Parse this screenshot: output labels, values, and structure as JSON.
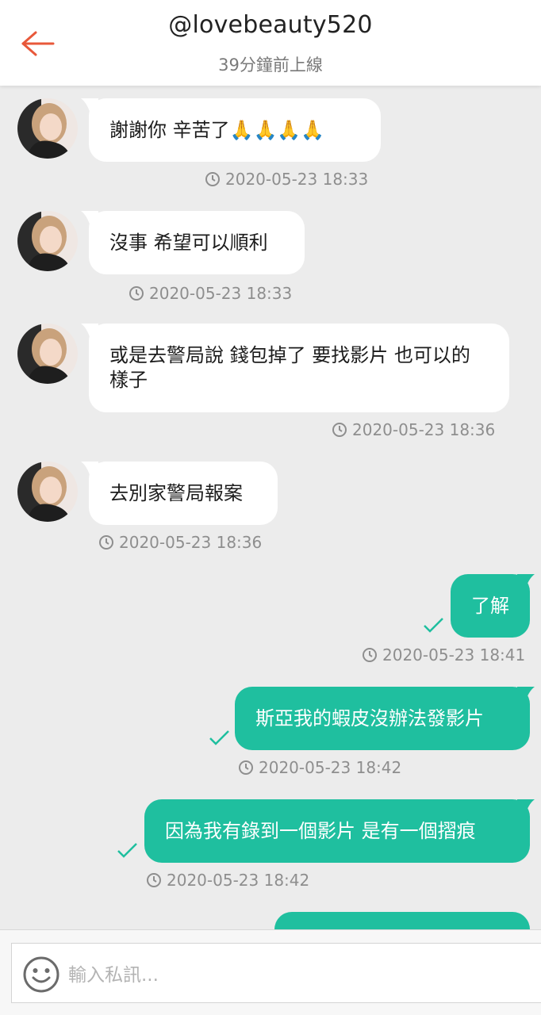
{
  "header": {
    "username": "@lovebeauty520",
    "status": "39分鐘前上線"
  },
  "colors": {
    "accent": "#e8583a",
    "outgoing_bubble": "#1fbf9f",
    "incoming_bubble": "#ffffff",
    "background": "#ececec"
  },
  "messages": [
    {
      "direction": "incoming",
      "text": "謝謝你 辛苦了🙏🙏🙏🙏",
      "time": "2020-05-23 18:33"
    },
    {
      "direction": "incoming",
      "text": "沒事 希望可以順利",
      "time": "2020-05-23 18:33"
    },
    {
      "direction": "incoming",
      "text": "或是去警局說 錢包掉了 要找影片 也可以的樣子",
      "time": "2020-05-23 18:36"
    },
    {
      "direction": "incoming",
      "text": "去別家警局報案",
      "time": "2020-05-23 18:36"
    },
    {
      "direction": "outgoing",
      "text": "了解",
      "time": "2020-05-23 18:41"
    },
    {
      "direction": "outgoing",
      "text": "斯亞我的蝦皮沒辦法發影片",
      "time": "2020-05-23 18:42"
    },
    {
      "direction": "outgoing",
      "text": "因為我有錄到一個影片 是有一個摺痕",
      "time": "2020-05-23 18:42"
    }
  ],
  "composer": {
    "placeholder": "輸入私訊..."
  },
  "icons": {
    "back": "arrow-left-icon",
    "emoji": "smiley-icon",
    "clock": "clock-icon",
    "sent": "checkmark-icon"
  }
}
